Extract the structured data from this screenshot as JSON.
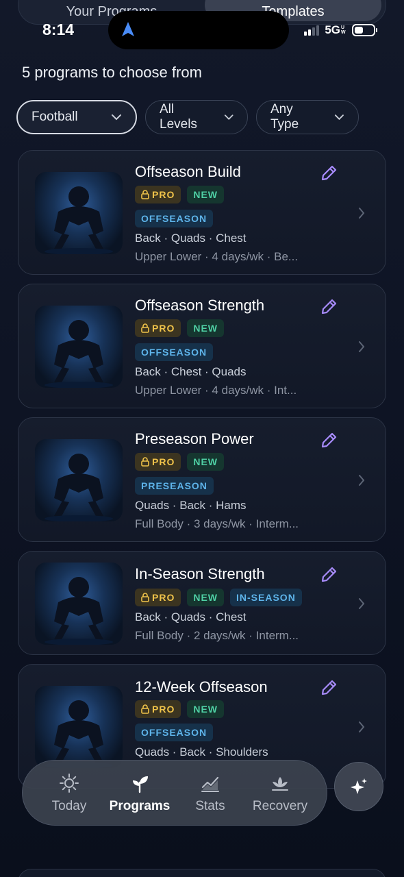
{
  "segment": {
    "left_label": "Your Programs",
    "right_label": "Templates"
  },
  "status": {
    "time": "8:14",
    "network": "5G",
    "network_suffix": "UW"
  },
  "count_text": "5 programs to choose from",
  "filters": [
    {
      "label": "Football",
      "active": true
    },
    {
      "label": "All Levels",
      "active": false
    },
    {
      "label": "Any Type",
      "active": false
    }
  ],
  "programs": [
    {
      "title": "Offseason Build",
      "pro": "PRO",
      "new": "NEW",
      "phase": "OFFSEASON",
      "muscles": "Back · Quads · Chest",
      "meta": "Upper Lower · 4 days/wk · Be..."
    },
    {
      "title": "Offseason Strength",
      "pro": "PRO",
      "new": "NEW",
      "phase": "OFFSEASON",
      "muscles": "Back · Chest · Quads",
      "meta": "Upper Lower · 4 days/wk · Int..."
    },
    {
      "title": "Preseason Power",
      "pro": "PRO",
      "new": "NEW",
      "phase": "PRESEASON",
      "muscles": "Quads · Back · Hams",
      "meta": "Full Body · 3 days/wk · Interm..."
    },
    {
      "title": "In-Season Strength",
      "pro": "PRO",
      "new": "NEW",
      "phase": "IN-SEASON",
      "muscles": "Back · Quads · Chest",
      "meta": "Full Body · 2 days/wk · Interm..."
    },
    {
      "title": "12-Week Offseason",
      "pro": "PRO",
      "new": "NEW",
      "phase": "OFFSEASON",
      "muscles": "Quads · Back · Shoulders",
      "meta": ""
    }
  ],
  "tabs": [
    {
      "label": "Today",
      "icon": "sun-icon"
    },
    {
      "label": "Programs",
      "icon": "sprout-icon"
    },
    {
      "label": "Stats",
      "icon": "chart-line-icon"
    },
    {
      "label": "Recovery",
      "icon": "lotus-icon"
    }
  ],
  "colors": {
    "pro": "#f0c34a",
    "new": "#4fd1a5",
    "phase": "#5eb4ea",
    "edit": "#a78bfa"
  }
}
